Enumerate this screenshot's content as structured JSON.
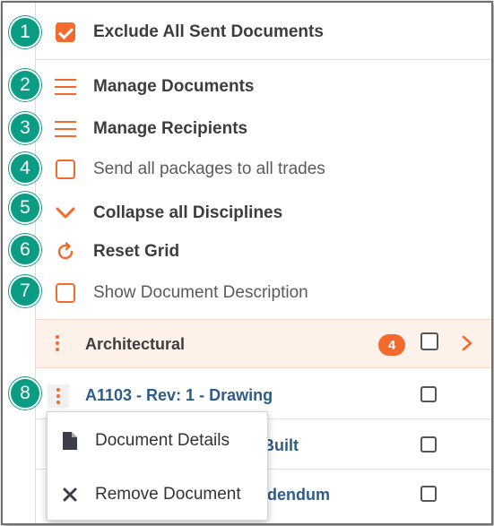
{
  "menu_items": [
    {
      "label": "Exclude All Sent Documents",
      "icon": "checkbox-checked-icon",
      "style": "bold"
    },
    {
      "label": "Manage Documents",
      "icon": "hamburger-icon",
      "style": "bold"
    },
    {
      "label": "Manage Recipients",
      "icon": "hamburger-icon",
      "style": "bold"
    },
    {
      "label": "Send all packages to all trades",
      "icon": "checkbox-icon",
      "style": "normal"
    },
    {
      "label": "Collapse all Disciplines",
      "icon": "chevron-down-icon",
      "style": "bold"
    },
    {
      "label": "Reset Grid",
      "icon": "refresh-icon",
      "style": "bold"
    },
    {
      "label": "Show Document Description",
      "icon": "checkbox-icon",
      "style": "normal"
    }
  ],
  "callouts": [
    "1",
    "2",
    "3",
    "4",
    "5",
    "6",
    "7",
    "8"
  ],
  "group": {
    "name": "Architectural",
    "count": "4"
  },
  "documents": [
    {
      "title": "A1103 - Rev: 1 - Drawing"
    },
    {
      "title": "Built"
    },
    {
      "title": "dendum"
    }
  ],
  "context_menu": {
    "details_label": "Document Details",
    "remove_label": "Remove Document"
  },
  "colors": {
    "accent": "#f26a2e",
    "callout": "#0a9d83",
    "link": "#2b5c8a",
    "group_bg": "#fdf1ea"
  }
}
